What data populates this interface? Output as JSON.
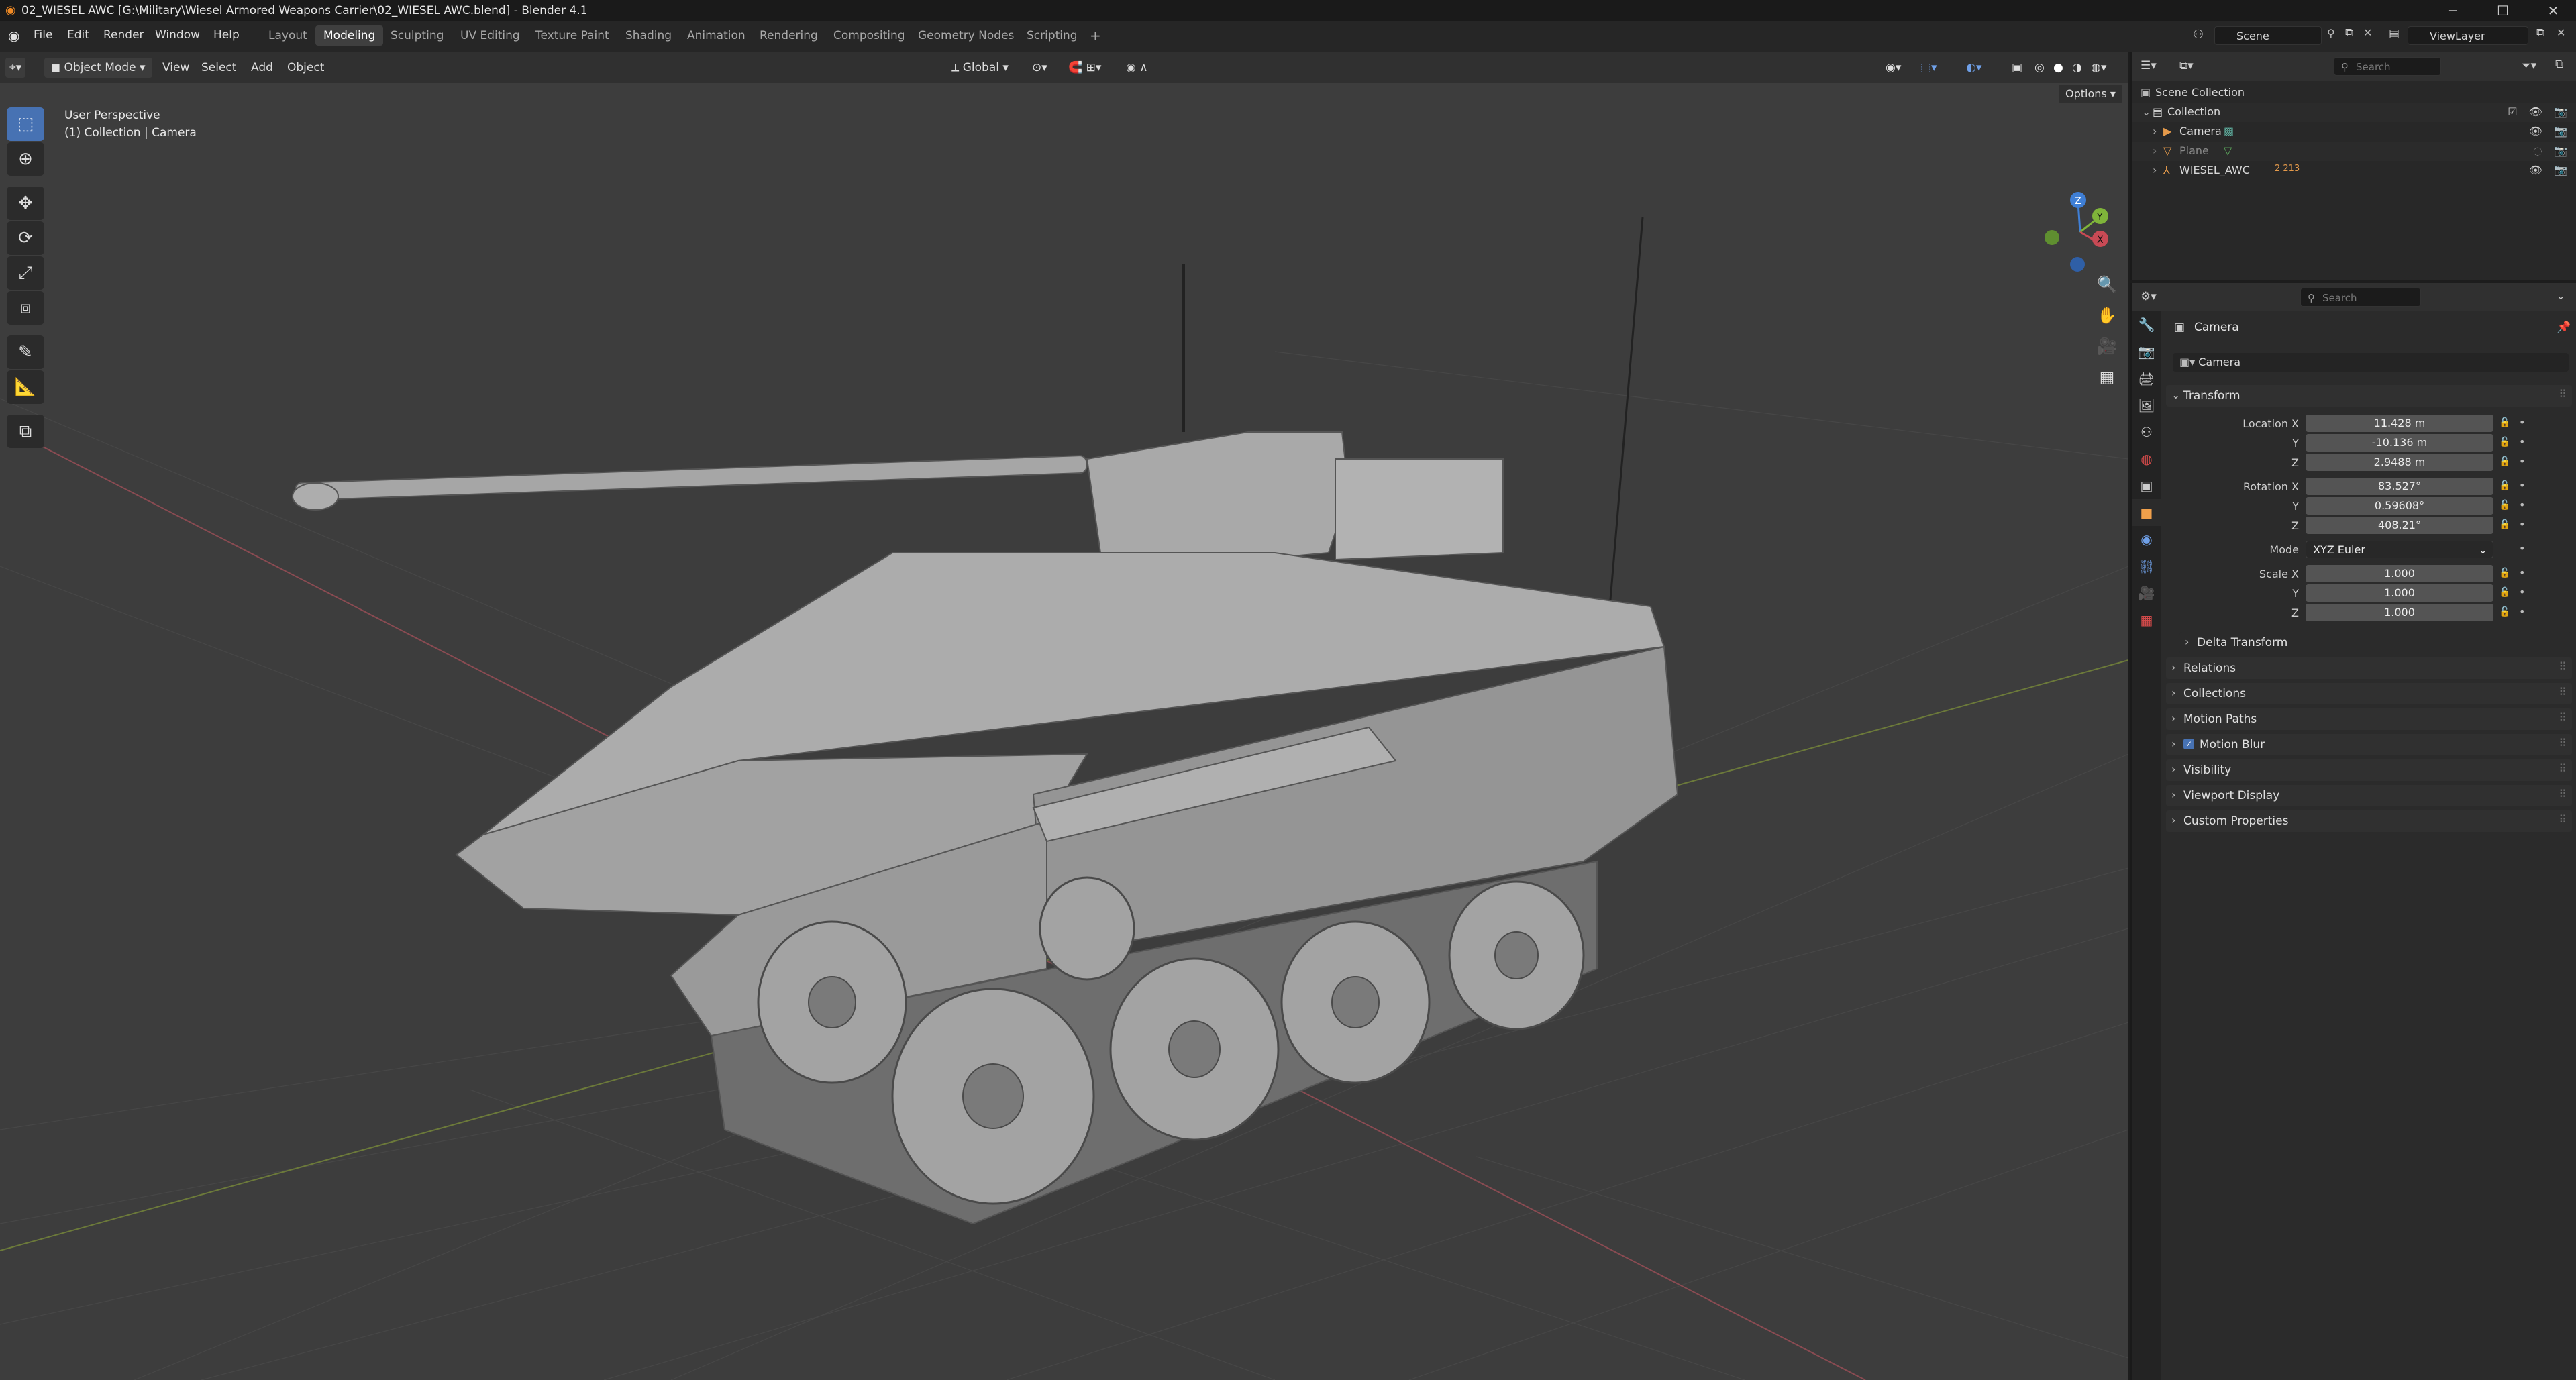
{
  "window": {
    "title": "02_WIESEL AWC [G:\\Military\\Wiesel Armored Weapons Carrier\\02_WIESEL AWC.blend] - Blender 4.1",
    "minimize": "─",
    "maximize": "☐",
    "close": "✕"
  },
  "menus": [
    "File",
    "Edit",
    "Render",
    "Window",
    "Help"
  ],
  "workspaces": [
    "Layout",
    "Modeling",
    "Sculpting",
    "UV Editing",
    "Texture Paint",
    "Shading",
    "Animation",
    "Rendering",
    "Compositing",
    "Geometry Nodes",
    "Scripting"
  ],
  "workspace_add": "+",
  "scene": {
    "label": "Scene",
    "viewlayer": "ViewLayer"
  },
  "viewport_header": {
    "mode": "Object Mode",
    "menus": [
      "View",
      "Select",
      "Add",
      "Object"
    ],
    "orientation": "Global",
    "options": "Options"
  },
  "viewport": {
    "perspective": "User Perspective",
    "collection": "(1) Collection | Camera",
    "gizmo": {
      "z": "Z",
      "y": "Y",
      "x": "X"
    }
  },
  "outliner": {
    "search_placeholder": "Search",
    "root": "Scene Collection",
    "collection": "Collection",
    "items": [
      {
        "name": "Camera",
        "icon": "camera-icon"
      },
      {
        "name": "Plane",
        "icon": "mesh-icon"
      },
      {
        "name": "WIESEL_AWC",
        "icon": "armature-icon",
        "badge": "2 213"
      }
    ]
  },
  "properties": {
    "search_placeholder": "Search",
    "object_label": "Camera",
    "object_field": "Camera",
    "transform_title": "Transform",
    "location_label": "Location X",
    "location": [
      "11.428 m",
      "-10.136 m",
      "2.9488 m"
    ],
    "rotation_label": "Rotation X",
    "rotation": [
      "83.527°",
      "0.59608°",
      "408.21°"
    ],
    "mode_label": "Mode",
    "mode_value": "XYZ Euler",
    "scale_label": "Scale X",
    "scale": [
      "1.000",
      "1.000",
      "1.000"
    ],
    "axis_y": "Y",
    "axis_z": "Z",
    "delta": "Delta Transform",
    "panels": [
      "Relations",
      "Collections",
      "Motion Paths",
      "Motion Blur",
      "Visibility",
      "Viewport Display",
      "Custom Properties"
    ]
  },
  "colors": {
    "accent": "#4772b3",
    "x_axis": "#c84a55",
    "y_axis": "#7fb43a",
    "z_axis": "#3f7fd6",
    "viewport_bg": "#3d3d3d"
  }
}
